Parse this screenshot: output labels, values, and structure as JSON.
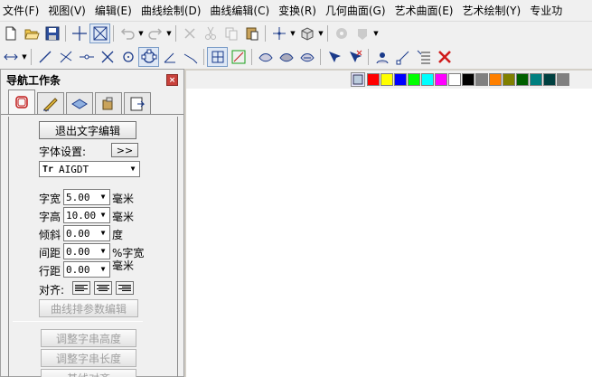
{
  "menu": [
    "文件(F)",
    "视图(V)",
    "编辑(E)",
    "曲线绘制(D)",
    "曲线编辑(C)",
    "变换(R)",
    "几何曲面(G)",
    "艺术曲面(E)",
    "艺术绘制(Y)",
    "专业功"
  ],
  "panel": {
    "title": "导航工作条",
    "close_label": "×",
    "exit_button": "退出文字编辑",
    "font_setting_label": "字体设置:",
    "font_setting_button": ">>",
    "font_value": "AIGDT",
    "font_icon_text": "Tr",
    "width_label": "字宽",
    "width_value": "5.00",
    "width_unit": "毫米",
    "height_label": "字高",
    "height_value": "10.00",
    "height_unit": "毫米",
    "slant_label": "倾斜",
    "slant_value": "0.00",
    "slant_unit": "度",
    "spacing_label": "间距",
    "spacing_value": "0.00",
    "spacing_unit": "%字宽",
    "line_spacing_label": "行距",
    "line_spacing_value": "0.00",
    "line_spacing_unit": "毫米",
    "align_label": "对齐:",
    "curve_param_button": "曲线排参数编辑",
    "adjust_height_button": "调整字串高度",
    "adjust_length_button": "调整字串长度",
    "baseline_button": "基线对齐"
  },
  "palette_colors": [
    "#ff0000",
    "#ffff00",
    "#0000ff",
    "#00ff00",
    "#00ffff",
    "#ff00ff",
    "#ffffff",
    "#000000",
    "#808080",
    "#ff8000",
    "#808000",
    "#006000",
    "#008080",
    "#004040",
    "#808080"
  ]
}
